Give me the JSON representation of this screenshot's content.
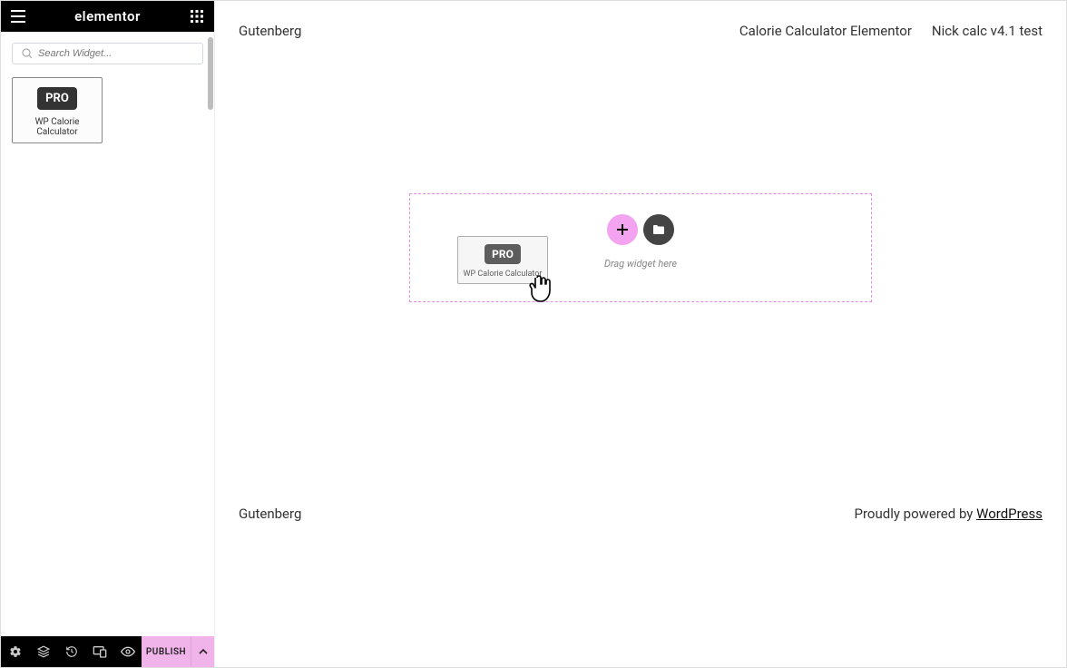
{
  "panel": {
    "brand": "elementor",
    "search_placeholder": "Search Widget...",
    "widget": {
      "badge": "PRO",
      "label": "WP Calorie Calculator"
    }
  },
  "footer": {
    "publish_label": "PUBLISH"
  },
  "preview": {
    "top_left": "Gutenberg",
    "top_links": [
      "Calorie Calculator Elementor",
      "Nick calc v4.1 test"
    ],
    "drop_hint": "Drag widget here",
    "dragging": {
      "badge": "PRO",
      "label": "WP Calorie Calculator"
    },
    "footer_left": "Gutenberg",
    "footer_right_prefix": "Proudly powered by ",
    "footer_right_link": "WordPress"
  }
}
